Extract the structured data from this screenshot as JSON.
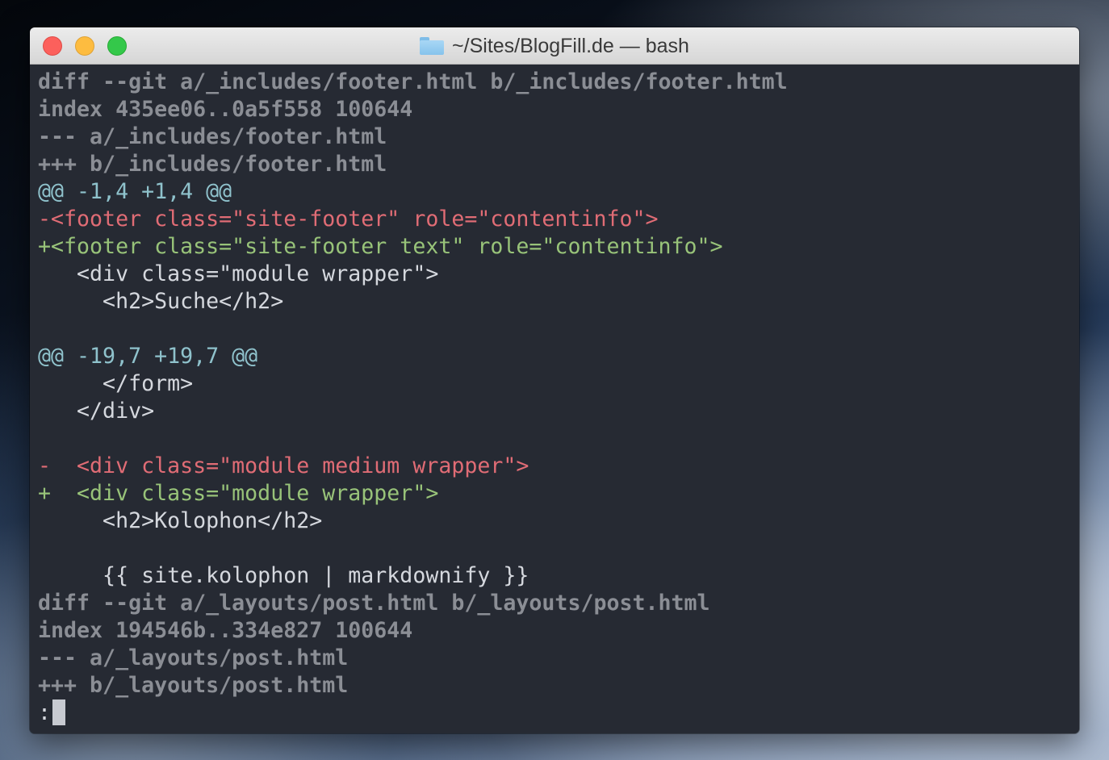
{
  "window": {
    "title": "~/Sites/BlogFill.de — bash",
    "folder_icon": "folder-icon",
    "buttons": [
      "close",
      "minimize",
      "maximize"
    ]
  },
  "colors": {
    "background": "#262a33",
    "meta": "#8b8e95",
    "hunk": "#8fc2cc",
    "deleted": "#e06c75",
    "added": "#98c379",
    "context": "#d5d8de"
  },
  "terminal": {
    "lines": [
      {
        "type": "meta",
        "text": "diff --git a/_includes/footer.html b/_includes/footer.html"
      },
      {
        "type": "meta",
        "text": "index 435ee06..0a5f558 100644"
      },
      {
        "type": "meta",
        "text": "--- a/_includes/footer.html"
      },
      {
        "type": "meta",
        "text": "+++ b/_includes/footer.html"
      },
      {
        "type": "hunk",
        "text": "@@ -1,4 +1,4 @@"
      },
      {
        "type": "del",
        "text": "-<footer class=\"site-footer\" role=\"contentinfo\">"
      },
      {
        "type": "add",
        "text": "+<footer class=\"site-footer text\" role=\"contentinfo\">"
      },
      {
        "type": "ctx",
        "text": "   <div class=\"module wrapper\">"
      },
      {
        "type": "ctx",
        "text": "     <h2>Suche</h2>"
      },
      {
        "type": "ctx",
        "text": ""
      },
      {
        "type": "hunk",
        "text": "@@ -19,7 +19,7 @@"
      },
      {
        "type": "ctx",
        "text": "     </form>"
      },
      {
        "type": "ctx",
        "text": "   </div>"
      },
      {
        "type": "ctx",
        "text": ""
      },
      {
        "type": "del",
        "text": "-  <div class=\"module medium wrapper\">"
      },
      {
        "type": "add",
        "text": "+  <div class=\"module wrapper\">"
      },
      {
        "type": "ctx",
        "text": "     <h2>Kolophon</h2>"
      },
      {
        "type": "ctx",
        "text": ""
      },
      {
        "type": "ctx",
        "text": "     {{ site.kolophon | markdownify }}"
      },
      {
        "type": "meta",
        "text": "diff --git a/_layouts/post.html b/_layouts/post.html"
      },
      {
        "type": "meta",
        "text": "index 194546b..334e827 100644"
      },
      {
        "type": "meta",
        "text": "--- a/_layouts/post.html"
      },
      {
        "type": "meta",
        "text": "+++ b/_layouts/post.html"
      }
    ],
    "prompt": ":"
  }
}
